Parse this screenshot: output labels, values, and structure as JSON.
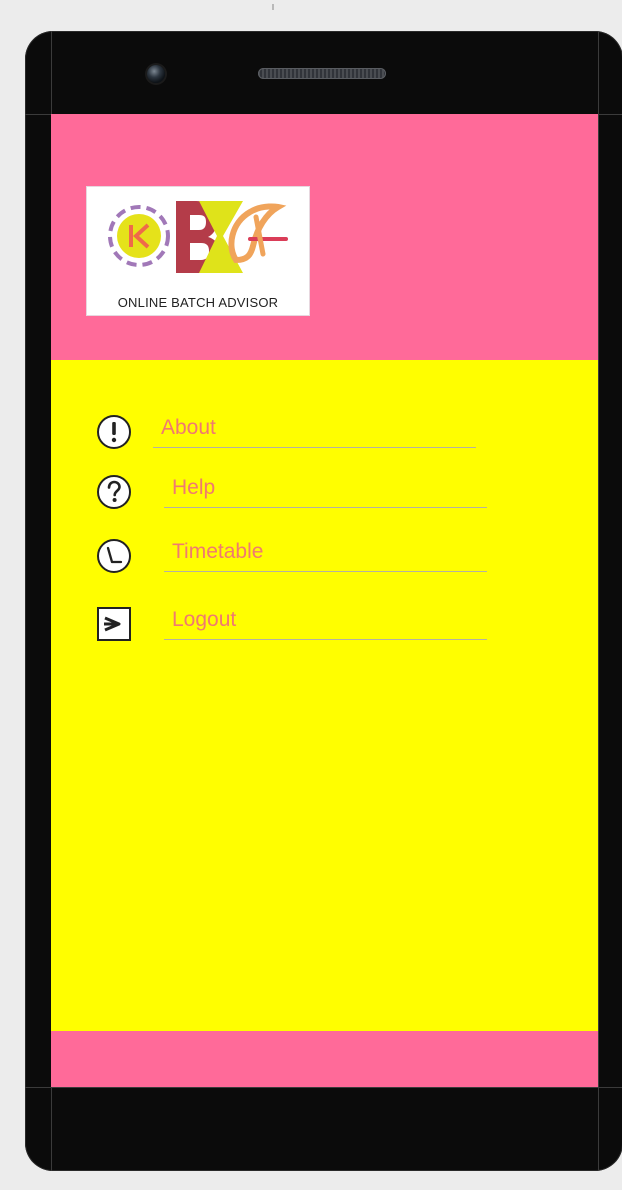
{
  "app": {
    "brand_text": "ONLINE BATCH ADVISOR"
  },
  "menu": {
    "items": [
      {
        "label": "About",
        "icon": "info-icon"
      },
      {
        "label": "Help",
        "icon": "help-icon"
      },
      {
        "label": "Timetable",
        "icon": "clock-icon"
      },
      {
        "label": "Logout",
        "icon": "logout-icon"
      }
    ]
  },
  "theme": {
    "header_color": "#ff6a99",
    "drawer_color": "#fffe00",
    "label_color": "#f07a70",
    "frame_color": "#0b0b0b"
  }
}
